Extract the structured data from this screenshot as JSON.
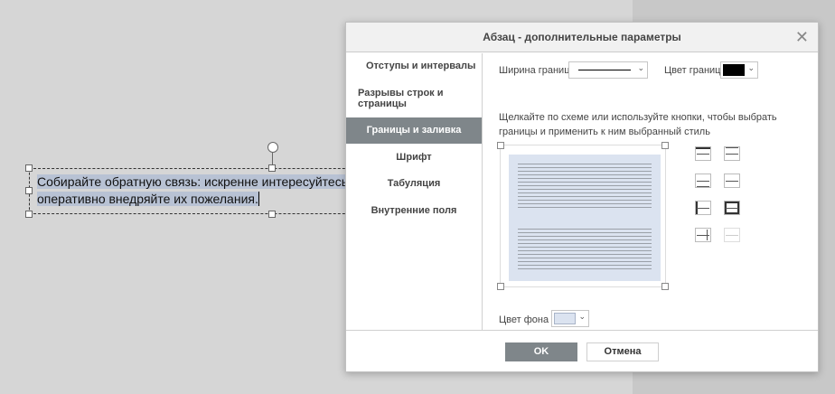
{
  "document": {
    "line1": "Собирайте обратную связь: искренне интересуйтесь",
    "line2": "оперативно внедряйте их пожелания."
  },
  "dialog": {
    "title": "Абзац - дополнительные параметры",
    "close_icon": "close-icon",
    "nav": [
      {
        "label": "Отступы и интервалы"
      },
      {
        "label": "Разрывы строк и страницы"
      },
      {
        "label": "Границы и заливка"
      },
      {
        "label": "Шрифт"
      },
      {
        "label": "Табуляция"
      },
      {
        "label": "Внутренние поля"
      }
    ],
    "active_nav": "Границы и заливка",
    "border_width_label": "Ширина границ",
    "border_color_label": "Цвет границ",
    "border_color": "#000000",
    "hint": "Щелкайте по схеме или используйте кнопки, чтобы выбрать границы и применить к ним выбранный стиль",
    "bg_color_label": "Цвет фона",
    "bg_color": "#dbe3f0",
    "ok_label": "OK",
    "cancel_label": "Отмена"
  },
  "colors": {
    "accent": "#7f868a",
    "selection": "#b8c2d4"
  }
}
